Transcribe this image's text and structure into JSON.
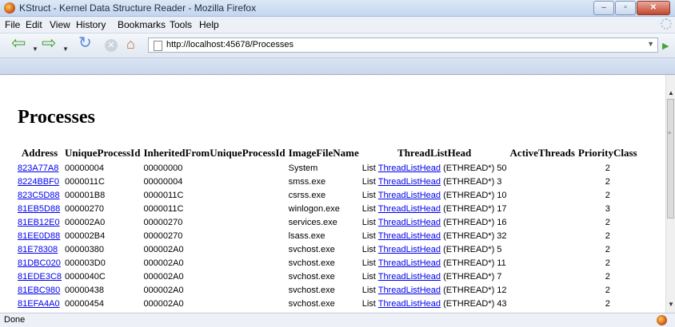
{
  "window": {
    "title": "KStruct - Kernel Data Structure Reader - Mozilla Firefox"
  },
  "menu": [
    "File",
    "Edit",
    "View",
    "History",
    "Bookmarks",
    "Tools",
    "Help"
  ],
  "nav": {
    "url": "http://localhost:45678/Processes"
  },
  "page": {
    "heading": "Processes",
    "columns": [
      "Address",
      "UniqueProcessId",
      "InheritedFromUniqueProcessId",
      "ImageFileName",
      "ThreadListHead",
      "ActiveThreads",
      "PriorityClass"
    ],
    "list_prefix": "List",
    "link_text": "ThreadListHead",
    "type_suffix": "(ETHREAD*)",
    "rows": [
      {
        "address": "823A77A8",
        "pid": "00000004",
        "ppid": "00000000",
        "image": "System",
        "threads": "50",
        "priority": "2"
      },
      {
        "address": "8224BBF0",
        "pid": "0000011C",
        "ppid": "00000004",
        "image": "smss.exe",
        "threads": "3",
        "priority": "2"
      },
      {
        "address": "823C5D88",
        "pid": "000001B8",
        "ppid": "0000011C",
        "image": "csrss.exe",
        "threads": "10",
        "priority": "2"
      },
      {
        "address": "81EB5D88",
        "pid": "00000270",
        "ppid": "0000011C",
        "image": "winlogon.exe",
        "threads": "17",
        "priority": "3"
      },
      {
        "address": "81EB12E0",
        "pid": "000002A0",
        "ppid": "00000270",
        "image": "services.exe",
        "threads": "16",
        "priority": "2"
      },
      {
        "address": "81EE0D88",
        "pid": "000002B4",
        "ppid": "00000270",
        "image": "lsass.exe",
        "threads": "32",
        "priority": "2"
      },
      {
        "address": "81E78308",
        "pid": "00000380",
        "ppid": "000002A0",
        "image": "svchost.exe",
        "threads": "5",
        "priority": "2"
      },
      {
        "address": "81DBC020",
        "pid": "000003D0",
        "ppid": "000002A0",
        "image": "svchost.exe",
        "threads": "11",
        "priority": "2"
      },
      {
        "address": "81EDE3C8",
        "pid": "0000040C",
        "ppid": "000002A0",
        "image": "svchost.exe",
        "threads": "7",
        "priority": "2"
      },
      {
        "address": "81EBC980",
        "pid": "00000438",
        "ppid": "000002A0",
        "image": "svchost.exe",
        "threads": "12",
        "priority": "2"
      },
      {
        "address": "81EFA4A0",
        "pid": "00000454",
        "ppid": "000002A0",
        "image": "svchost.exe",
        "threads": "43",
        "priority": "2"
      }
    ]
  },
  "status": {
    "text": "Done"
  },
  "colors": {
    "link": "#0000ee",
    "titlebar": "#c3d6ee"
  }
}
